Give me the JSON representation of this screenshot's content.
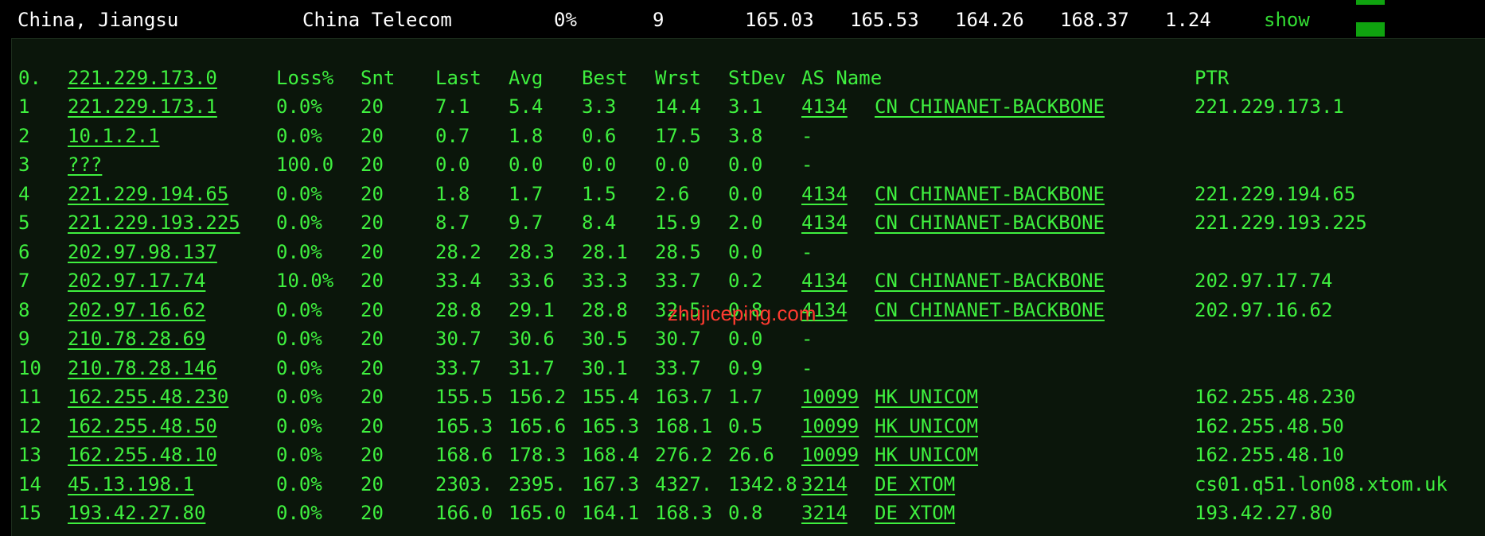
{
  "summary": {
    "location": "China, Jiangsu",
    "isp": "China Telecom",
    "loss": "0%",
    "hops": "9",
    "last": "165.03",
    "avg": "165.53",
    "best": "164.26",
    "worst": "168.37",
    "stdev": "1.24",
    "show_label": "show"
  },
  "header": {
    "hop": "0.",
    "host": "221.229.173.0",
    "loss": "Loss%",
    "snt": "Snt",
    "last": "Last",
    "avg": "Avg",
    "best": "Best",
    "wrst": "Wrst",
    "stdev": "StDev",
    "as_name": "AS Name",
    "ptr": "PTR"
  },
  "rows": [
    {
      "hop": "1",
      "host": "221.229.173.1",
      "loss": "0.0%",
      "snt": "20",
      "last": "7.1",
      "avg": "5.4",
      "best": "3.3",
      "wrst": "14.4",
      "stdev": "3.1",
      "asn": "4134",
      "as_name": "CN CHINANET-BACKBONE",
      "ptr": "221.229.173.1"
    },
    {
      "hop": "2",
      "host": "10.1.2.1",
      "loss": "0.0%",
      "snt": "20",
      "last": "0.7",
      "avg": "1.8",
      "best": "0.6",
      "wrst": "17.5",
      "stdev": "3.8",
      "asn": "-",
      "as_name": "",
      "ptr": ""
    },
    {
      "hop": "3",
      "host": "???",
      "loss": "100.0",
      "snt": "20",
      "last": "0.0",
      "avg": "0.0",
      "best": "0.0",
      "wrst": "0.0",
      "stdev": "0.0",
      "asn": "-",
      "as_name": "",
      "ptr": ""
    },
    {
      "hop": "4",
      "host": "221.229.194.65",
      "loss": "0.0%",
      "snt": "20",
      "last": "1.8",
      "avg": "1.7",
      "best": "1.5",
      "wrst": "2.6",
      "stdev": "0.0",
      "asn": "4134",
      "as_name": "CN CHINANET-BACKBONE",
      "ptr": "221.229.194.65"
    },
    {
      "hop": "5",
      "host": "221.229.193.225",
      "loss": "0.0%",
      "snt": "20",
      "last": "8.7",
      "avg": "9.7",
      "best": "8.4",
      "wrst": "15.9",
      "stdev": "2.0",
      "asn": "4134",
      "as_name": "CN CHINANET-BACKBONE",
      "ptr": "221.229.193.225"
    },
    {
      "hop": "6",
      "host": "202.97.98.137",
      "loss": "0.0%",
      "snt": "20",
      "last": "28.2",
      "avg": "28.3",
      "best": "28.1",
      "wrst": "28.5",
      "stdev": "0.0",
      "asn": "-",
      "as_name": "",
      "ptr": ""
    },
    {
      "hop": "7",
      "host": "202.97.17.74",
      "loss": "10.0%",
      "snt": "20",
      "last": "33.4",
      "avg": "33.6",
      "best": "33.3",
      "wrst": "33.7",
      "stdev": "0.2",
      "asn": "4134",
      "as_name": "CN CHINANET-BACKBONE",
      "ptr": "202.97.17.74"
    },
    {
      "hop": "8",
      "host": "202.97.16.62",
      "loss": "0.0%",
      "snt": "20",
      "last": "28.8",
      "avg": "29.1",
      "best": "28.8",
      "wrst": "32.5",
      "stdev": "0.8",
      "asn": "4134",
      "as_name": "CN CHINANET-BACKBONE",
      "ptr": "202.97.16.62"
    },
    {
      "hop": "9",
      "host": "210.78.28.69",
      "loss": "0.0%",
      "snt": "20",
      "last": "30.7",
      "avg": "30.6",
      "best": "30.5",
      "wrst": "30.7",
      "stdev": "0.0",
      "asn": "-",
      "as_name": "",
      "ptr": ""
    },
    {
      "hop": "10",
      "host": "210.78.28.146",
      "loss": "0.0%",
      "snt": "20",
      "last": "33.7",
      "avg": "31.7",
      "best": "30.1",
      "wrst": "33.7",
      "stdev": "0.9",
      "asn": "-",
      "as_name": "",
      "ptr": ""
    },
    {
      "hop": "11",
      "host": "162.255.48.230",
      "loss": "0.0%",
      "snt": "20",
      "last": "155.5",
      "avg": "156.2",
      "best": "155.4",
      "wrst": "163.7",
      "stdev": "1.7",
      "asn": "10099",
      "as_name": "HK UNICOM",
      "ptr": "162.255.48.230"
    },
    {
      "hop": "12",
      "host": "162.255.48.50",
      "loss": "0.0%",
      "snt": "20",
      "last": "165.3",
      "avg": "165.6",
      "best": "165.3",
      "wrst": "168.1",
      "stdev": "0.5",
      "asn": "10099",
      "as_name": "HK UNICOM",
      "ptr": "162.255.48.50"
    },
    {
      "hop": "13",
      "host": "162.255.48.10",
      "loss": "0.0%",
      "snt": "20",
      "last": "168.6",
      "avg": "178.3",
      "best": "168.4",
      "wrst": "276.2",
      "stdev": "26.6",
      "asn": "10099",
      "as_name": "HK UNICOM",
      "ptr": "162.255.48.10"
    },
    {
      "hop": "14",
      "host": "45.13.198.1",
      "loss": "0.0%",
      "snt": "20",
      "last": "2303.",
      "avg": "2395.",
      "best": "167.3",
      "wrst": "4327.",
      "stdev": "1342.8",
      "asn": "3214",
      "as_name": "DE XTOM",
      "ptr": "cs01.q51.lon08.xtom.uk"
    },
    {
      "hop": "15",
      "host": "193.42.27.80",
      "loss": "0.0%",
      "snt": "20",
      "last": "166.0",
      "avg": "165.0",
      "best": "164.1",
      "wrst": "168.3",
      "stdev": "0.8",
      "asn": "3214",
      "as_name": "DE XTOM",
      "ptr": "193.42.27.80"
    }
  ],
  "watermark": "zhujiceping.com",
  "colors": {
    "background": "#000000",
    "panel": "#0b160b",
    "text_green": "#3ff03f",
    "bar_green": "#0fa30f",
    "watermark": "#ff3b30"
  }
}
